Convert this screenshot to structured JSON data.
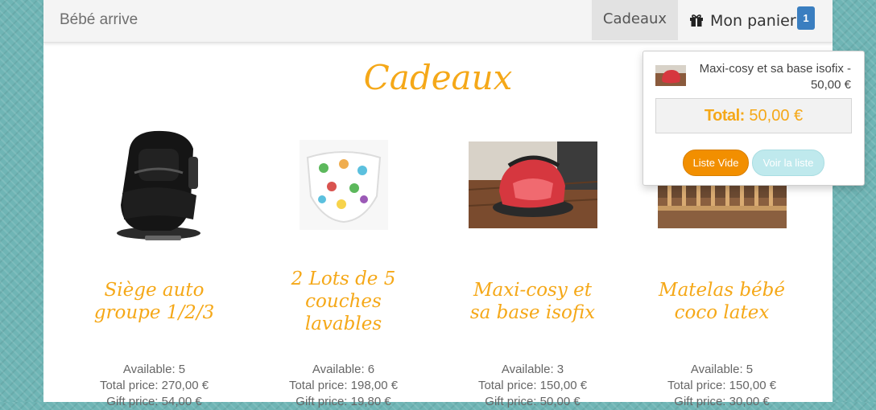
{
  "navbar": {
    "brand": "Bébé arrive",
    "gifts_link": "Cadeaux",
    "cart_label": "Mon panier",
    "cart_count": "1"
  },
  "page": {
    "title": "Cadeaux"
  },
  "products": [
    {
      "name": "Siège auto groupe 1/2/3",
      "available": "Available: 5",
      "total_price": "Total price: 270,00 €",
      "gift_price": "Gift price: 54,00 €"
    },
    {
      "name": "2 Lots de 5 couches lavables",
      "available": "Available: 6",
      "total_price": "Total price: 198,00 €",
      "gift_price": "Gift price: 19,80 €"
    },
    {
      "name": "Maxi-cosy et sa base isofix",
      "available": "Available: 3",
      "total_price": "Total price: 150,00 €",
      "gift_price": "Gift price: 50,00 €"
    },
    {
      "name": "Matelas bébé coco latex",
      "available": "Available: 5",
      "total_price": "Total price: 150,00 €",
      "gift_price": "Gift price: 30,00 €"
    }
  ],
  "cart_dropdown": {
    "item_text": "Maxi-cosy et sa base isofix - 50,00 €",
    "total_label": "Total:",
    "total_value": "50,00 €",
    "empty_button": "Liste Vide",
    "view_button": "Voir la liste"
  },
  "colors": {
    "accent": "#f5a818",
    "badge": "#3a7ec0",
    "empty_button": "#f28f00",
    "view_button": "#bfe9ed",
    "background": "#6fb5b5"
  }
}
